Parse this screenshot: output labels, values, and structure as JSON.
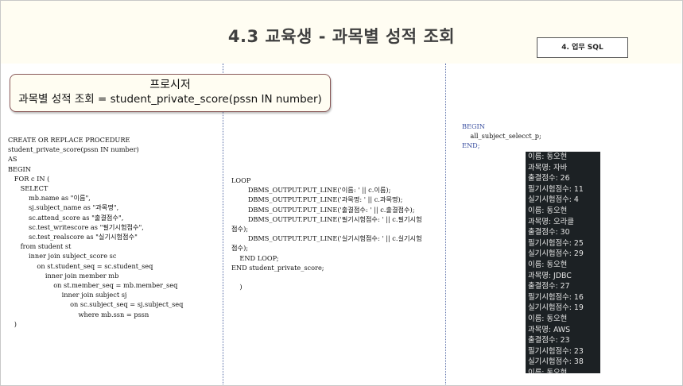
{
  "header": {
    "title": "4.3 교육생 - 과목별 성적 조회",
    "tag": "4. 업무 SQL"
  },
  "procedure_box": {
    "line1": "프로시저",
    "line2": "과목별 성적 조회 = student_private_score(pssn IN number)"
  },
  "code_left": [
    "CREATE OR REPLACE PROCEDURE",
    "student_private_score(pssn IN number)",
    "AS",
    "BEGIN",
    "   FOR c IN (",
    "      SELECT",
    "          mb.name as \"이름\",",
    "          sj.subject_name as \"과목명\",",
    "          sc.attend_score as \"출결점수\",",
    "          sc.test_writescore as \"필기시험점수\",",
    "          sc.test_realscore as \"실기시험점수\"",
    "      from student st",
    "          inner join subject_score sc",
    "              on st.student_seq = sc.student_seq",
    "                  inner join member mb",
    "                      on st.member_seq = mb.member_seq",
    "                          inner join subject sj",
    "                              on sc.subject_seq = sj.subject_seq",
    "                                  where mb.ssn = pssn",
    "   )"
  ],
  "code_mid": [
    "LOOP",
    "        DBMS_OUTPUT.PUT_LINE('이름: ' || c.이름);",
    "        DBMS_OUTPUT.PUT_LINE('과목명: ' || c.과목명);",
    "        DBMS_OUTPUT.PUT_LINE('출결점수: ' || c.출결점수);",
    "        DBMS_OUTPUT.PUT_LINE('필기시험점수: ' || c.필기시험",
    "점수);",
    "        DBMS_OUTPUT.PUT_LINE('실기시험점수: ' || c.실기시험",
    "점수);",
    "    END LOOP;",
    "END student_private_score;",
    "",
    "    )"
  ],
  "code_right": {
    "begin": "BEGIN",
    "call": "    all_subject_selecct_p;",
    "end": "END;"
  },
  "console_lines": [
    "이름: 동오현",
    "과목명: 자바",
    "출결점수: 26",
    "필기시험점수: 11",
    "실기시험점수: 4",
    "이름: 동오현",
    "과목명: 오라클",
    "출결점수: 30",
    "필기시험점수: 25",
    "실기시험점수: 29",
    "이름: 동오현",
    "과목명: JDBC",
    "출결점수: 27",
    "필기시험점수: 16",
    "실기시험점수: 19",
    "이름: 동오현",
    "과목명: AWS",
    "출결점수: 23",
    "필기시험점수: 23",
    "실기시험점수: 38",
    "이름: 동오현"
  ]
}
